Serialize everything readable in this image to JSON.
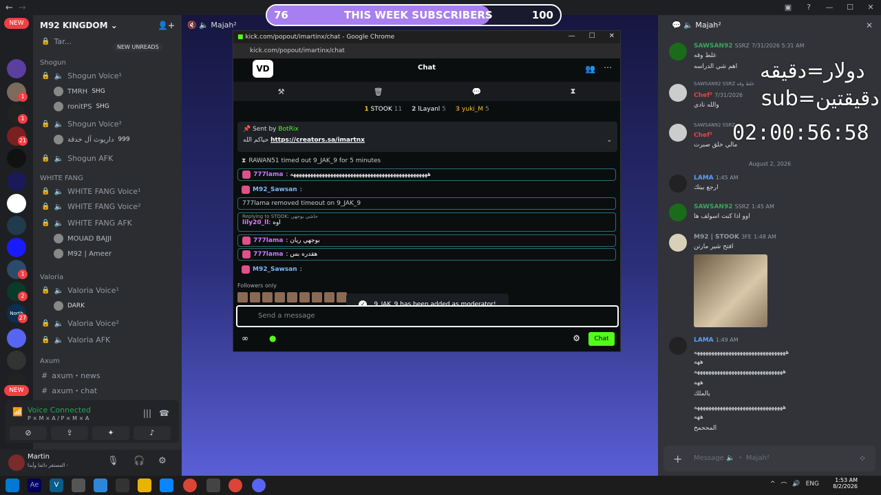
{
  "subscribers": {
    "current": "76",
    "label": "THIS WEEK SUBSCRIBERS",
    "goal": "100",
    "progress": 0.76
  },
  "discord": {
    "server_name": "M92 KINGDOM",
    "new_unreads": "NEW UNREADS",
    "rail_badges": {
      "top": "NEW",
      "bottom": "NEW",
      "north": "North",
      "counts": [
        "1",
        "1",
        "21",
        "1",
        "2",
        "27"
      ]
    },
    "truncated_channel": "Tar...",
    "categories": {
      "shogun": "Shogun",
      "white_fang": "WHITE FANG",
      "valoria": "Valoria",
      "axum": "Axum"
    },
    "channels": {
      "shogun_voice1": "Shogun Voice¹",
      "shogun_voice2": "Shogun Voice²",
      "shogun_afk": "Shogun AFK",
      "wf_voice1": "WHITE FANG Voice¹",
      "wf_voice2": "WHITE FANG Voice²",
      "wf_afk": "WHITE FANG AFK",
      "valoria_voice1": "Valoria Voice¹",
      "valoria_voice2": "Valoria Voice²",
      "valoria_afk": "Valoria AFK",
      "axum_news": "axum・news",
      "axum_chat": "axum・chat"
    },
    "voice_users": {
      "tmrh": "TMRH",
      "tmrh_tag": "SHG",
      "ronit": "ronitPS",
      "ronit_tag": "SHG",
      "shogun2_user": "داريوث آل خدقة",
      "shogun2_tag": "999",
      "mouad": "MOUAD BAJJI",
      "ameer": "M92 | Ameer",
      "dark_tag": "DARK"
    },
    "voice_connected": "Voice Connected",
    "voice_server": "P × M × A / P × M × A",
    "user_name": "Martin",
    "user_status": "المستقر دائما وأبدا -"
  },
  "stage_title": "Majah²",
  "popup": {
    "window_title": "kick.com/popout/imartinx/chat - Google Chrome",
    "url": "kick.com/popout/imartinx/chat",
    "chat_header": "Chat",
    "logo": "VD",
    "leaderboard": [
      {
        "rank": "1",
        "name": "STOOK",
        "count": "11"
      },
      {
        "rank": "2",
        "name": "lLayanl",
        "count": "5"
      },
      {
        "rank": "3",
        "name": "yuki_M",
        "count": "5"
      }
    ],
    "pinned": {
      "sent_by": "Sent by",
      "bot": "BotRix",
      "prefix": "حياكم الله",
      "link": "https://creators.sa/imartnx"
    },
    "messages": [
      {
        "text": "RAWAN51 timed out 9_JAK_9 for 5 minutes"
      },
      {
        "name": "777lama",
        "text": ": ههههههههههههههههههههههههههههههههههههههههههههههههه"
      },
      {
        "name": "M92_Sawsan",
        "text": ":"
      },
      {
        "text": "777lama removed timeout on 9_JAK_9"
      },
      {
        "reply": "Replying to STOOK: حاشي بوجهي",
        "name": "lily20_ll",
        "text": ": اوه"
      },
      {
        "name": "777lama",
        "text": ": بوجهي ريان"
      },
      {
        "name": "777lama",
        "text": ": هقدره بس"
      },
      {
        "name": "M92_Sawsan",
        "text": ":"
      }
    ],
    "followers_only": "Followers only",
    "toast": "9_JAK_9 has been added as moderator!",
    "input_placeholder": "Send a message",
    "chat_button": "Chat"
  },
  "right_panel": {
    "header": "Majah²",
    "overlay": {
      "line1": "دولار=دقيقه",
      "line2": "sub=دقيقتين",
      "timer": "02:00:56:58"
    },
    "date_divider": "August 2, 2026",
    "messages": [
      {
        "name": "SAWSAN92",
        "badge": "SSRZ",
        "time": "7/31/2026 5:31 AM",
        "lines": [
          "غلط وقه",
          "اهم شي الدراسه"
        ]
      },
      {
        "reply": "SAWSAN92 SSRZ غلط وقه",
        "name": "Chef²",
        "time": "7/31/2026",
        "lines": [
          "والله نادي"
        ]
      },
      {
        "reply": "SAWSAN92 SSRZ",
        "name": "Chef²",
        "lines": [
          "مالي خلق صبرت"
        ]
      },
      {
        "name": "LAMA",
        "time": "1:45 AM",
        "lines": [
          "ارجع بيتك"
        ]
      },
      {
        "name": "SAWSAN92",
        "badge": "SSRZ",
        "time": "1:45 AM",
        "lines": [
          "اوو اذا كنت اسولف ها"
        ]
      },
      {
        "name": "M92 | STOOK",
        "badge": "3FE",
        "time": "1:48 AM",
        "lines": [
          "افتح شير مارتن"
        ]
      },
      {
        "name": "LAMA",
        "time": "1:49 AM",
        "lines": [
          "ههههههههههههههههههههههههههههههههه",
          "ههه",
          "هههههههههههههههههههههههههههههههه",
          "ههه",
          "يالملك",
          "هههههههههههههههههههههههههههههههه",
          "ههه",
          "المححمح"
        ]
      }
    ],
    "input_placeholder": "Message 🔈 ・ Majah²"
  },
  "taskbar": {
    "lang": "ENG",
    "time": "1:53 AM",
    "date": "8/2/2026",
    "app_ae": "Ae",
    "app_v": "V"
  }
}
